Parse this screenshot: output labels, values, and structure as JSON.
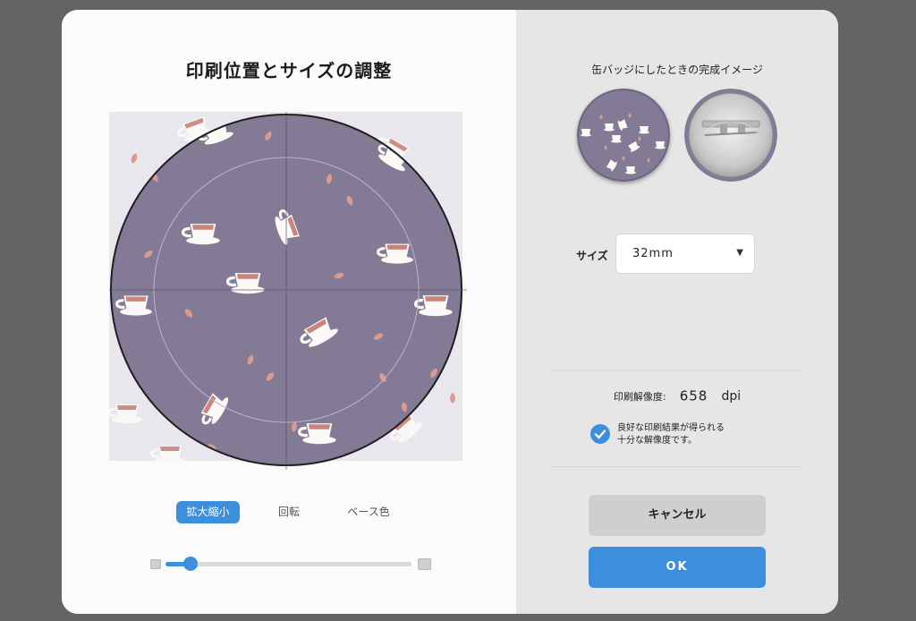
{
  "editor": {
    "title": "印刷位置とサイズの調整",
    "tabs": [
      {
        "label": "拡大縮小",
        "active": true
      },
      {
        "label": "回転",
        "active": false
      },
      {
        "label": "ベース色",
        "active": false
      }
    ],
    "zoom_level": 0.1,
    "pattern_colors": {
      "base": "#837a96",
      "outside": "#e9e6ee",
      "leaf": "#d99b8f",
      "cup": "#fbfaf7",
      "tea": "#c9857b"
    }
  },
  "preview": {
    "title": "缶バッジにしたときの完成イメージ"
  },
  "size": {
    "label": "サイズ",
    "selected": "32mm"
  },
  "resolution": {
    "label": "印刷解像度:",
    "value": "658",
    "unit": "dpi",
    "status_line1": "良好な印刷結果が得られる",
    "status_line2": "十分な解像度です。"
  },
  "buttons": {
    "cancel": "キャンセル",
    "ok": "OK"
  },
  "colors": {
    "accent": "#3b8fdc",
    "backdrop": "#646464",
    "right_panel": "#e6e6e6"
  }
}
